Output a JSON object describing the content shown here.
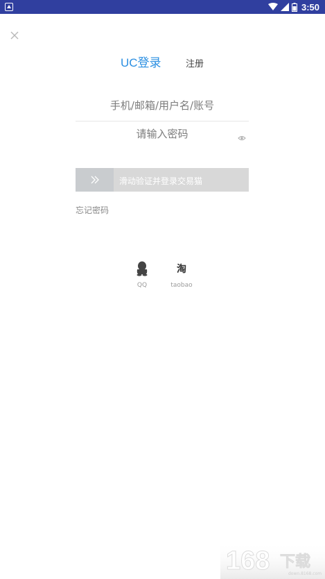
{
  "status_bar": {
    "time": "3:50"
  },
  "tabs": {
    "login": "UC登录",
    "register": "注册"
  },
  "form": {
    "account_placeholder": "手机/邮箱/用户名/账号",
    "password_placeholder": "请输入密码"
  },
  "slider": {
    "label": "滑动验证并登录交易猫",
    "handle_icon": "double-chevron-right-icon"
  },
  "forgot_password": "忘记密码",
  "social": [
    {
      "label": "QQ",
      "icon": "qq-penguin-icon"
    },
    {
      "label": "taobao",
      "icon": "taobao-icon",
      "glyph": "淘"
    }
  ],
  "watermark": {
    "logo": "168下载",
    "domain": "down.8168.com"
  },
  "colors": {
    "accent": "#2b8fe2",
    "status_bar": "#303f9f",
    "slider_bg": "#d8d8d8"
  }
}
